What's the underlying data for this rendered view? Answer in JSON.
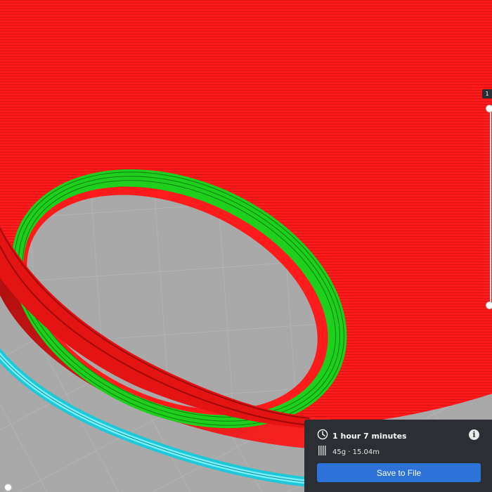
{
  "layer_slider": {
    "label": "1"
  },
  "print_panel": {
    "time_label": "1 hour 7 minutes",
    "material_label": "45g · 15.04m",
    "save_label": "Save to File",
    "time_icon": "clock-icon",
    "material_icon": "spool-icon",
    "info_icon": "info-icon"
  },
  "colors": {
    "outer_wall": "#ff1c1c",
    "inner_wall": "#22e422",
    "skirt": "#34d4e4",
    "build_plate": "#a9a9a9",
    "panel_background": "#2b2e32",
    "save_button": "#2c72d8"
  }
}
